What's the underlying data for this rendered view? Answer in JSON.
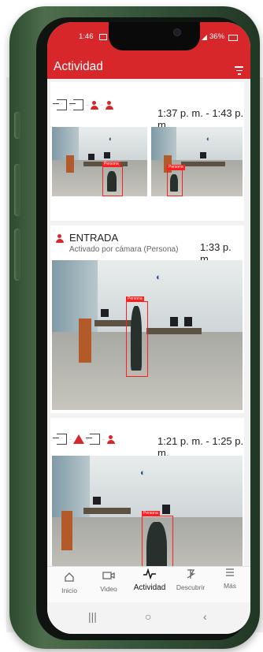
{
  "status_bar": {
    "time": "1:46",
    "battery": "36%"
  },
  "app_bar": {
    "title": "Actividad"
  },
  "events": [
    {
      "time": "1:37 p. m. - 1:43 p. m.",
      "detection_label": "Persona"
    },
    {
      "title": "ENTRADA",
      "subtitle": "Activado por cámara (Persona)",
      "time": "1:33 p. m.",
      "detection_label": "Persona"
    },
    {
      "time": "1:21 p. m. - 1:25 p. m.",
      "detection_label": "Persona"
    }
  ],
  "bottom_nav": [
    {
      "label": "Inicio",
      "icon": "home-icon"
    },
    {
      "label": "Video",
      "icon": "video-camera-icon"
    },
    {
      "label": "Actividad",
      "icon": "activity-pulse-icon",
      "active": true
    },
    {
      "label": "Descubrir",
      "icon": "discover-icon"
    },
    {
      "label": "Más",
      "icon": "menu-lines-icon"
    }
  ],
  "system_nav": {
    "recent": "|||",
    "home": "○",
    "back": "‹"
  },
  "colors": {
    "brand_red": "#d8272b",
    "phone_body": "#3b5a3c",
    "detection_box": "#ff1e1e"
  }
}
